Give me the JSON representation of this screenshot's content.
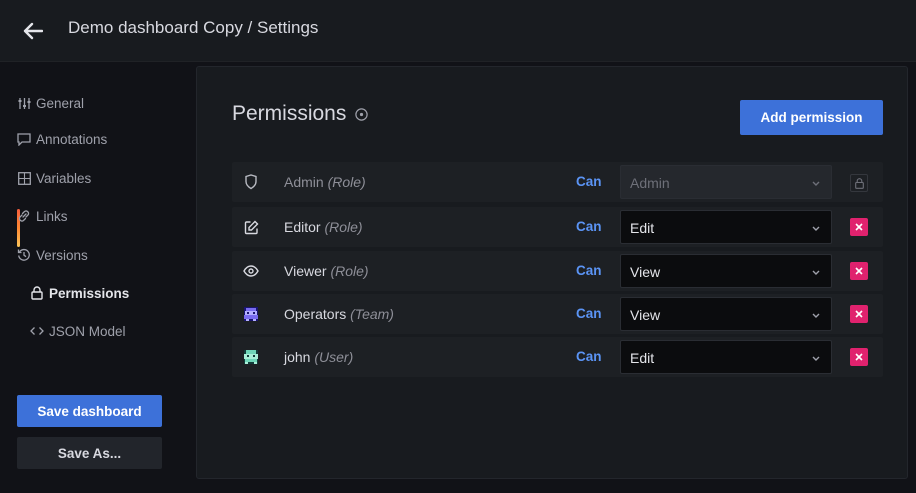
{
  "header": {
    "title": "Demo dashboard Copy / Settings",
    "back_icon": "arrow-left-icon"
  },
  "sidebar": {
    "items": [
      {
        "label": "General",
        "icon": "sliders-icon",
        "active": false
      },
      {
        "label": "Annotations",
        "icon": "comment-icon",
        "active": false
      },
      {
        "label": "Variables",
        "icon": "calculator-icon",
        "active": false
      },
      {
        "label": "Links",
        "icon": "link-icon",
        "active": false
      },
      {
        "label": "Versions",
        "icon": "history-icon",
        "active": false
      },
      {
        "label": "Permissions",
        "icon": "lock-icon",
        "active": true
      },
      {
        "label": "JSON Model",
        "icon": "code-icon",
        "active": false
      }
    ],
    "save_label": "Save dashboard",
    "save_as_label": "Save As..."
  },
  "permissions": {
    "title": "Permissions",
    "add_label": "Add permission",
    "rows": [
      {
        "name": "Admin",
        "type": "(Role)",
        "can": "Can",
        "value": "Admin",
        "icon": "shield-icon",
        "locked": true
      },
      {
        "name": "Editor",
        "type": "(Role)",
        "can": "Can",
        "value": "Edit",
        "icon": "edit-icon",
        "locked": false
      },
      {
        "name": "Viewer",
        "type": "(Role)",
        "can": "Can",
        "value": "View",
        "icon": "eye-icon",
        "locked": false
      },
      {
        "name": "Operators",
        "type": "(Team)",
        "can": "Can",
        "value": "View",
        "icon": "team-avatar-icon",
        "locked": false
      },
      {
        "name": "john",
        "type": "(User)",
        "can": "Can",
        "value": "Edit",
        "icon": "user-avatar-icon",
        "locked": false
      }
    ]
  },
  "colors": {
    "primary": "#3d71d9",
    "danger": "#e0226e",
    "can": "#5b94f5",
    "active_gradient": [
      "#f55f3e",
      "#fbc55a"
    ]
  }
}
